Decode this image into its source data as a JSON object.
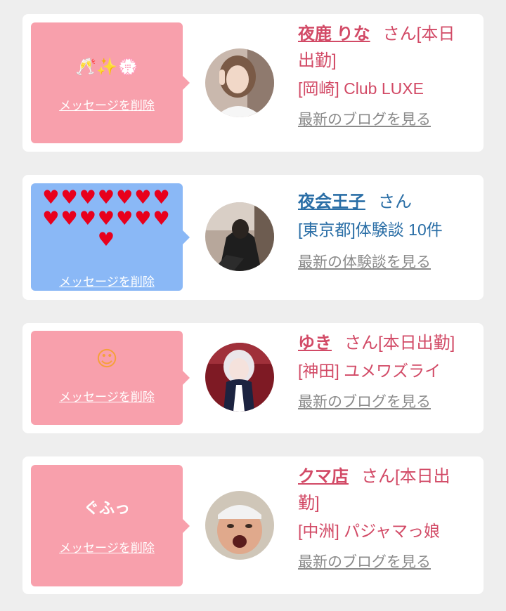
{
  "common": {
    "delete_label": "メッセージを削除"
  },
  "cards": [
    {
      "message": "🥂✨💮",
      "name": "夜鹿 りな",
      "suffix": "さん[本日出勤]",
      "detail": "[岡崎] Club LUXE",
      "link": "最新のブログを見る"
    },
    {
      "message": "♥♥♥♥♥♥♥♥♥♥♥♥♥♥♥",
      "name": "夜会王子",
      "suffix": "さん",
      "detail": "[東京都]体験談 10件",
      "link": "最新の体験談を見る"
    },
    {
      "message": "☺",
      "name": "ゆき",
      "suffix": "さん[本日出勤]",
      "detail": "[神田] ユメワズライ",
      "link": "最新のブログを見る"
    },
    {
      "message": "ぐふっ",
      "name": "クマ店",
      "suffix": "さん[本日出勤]",
      "detail": "[中洲] パジャマっ娘",
      "link": "最新のブログを見る"
    }
  ],
  "colors": {
    "bubble_pink": "#f8a0ac",
    "bubble_blue": "#8ab8f6",
    "text_pink": "#d24a66",
    "text_blue": "#2a6ea6",
    "link_gray": "#8a8a8a",
    "heart_red": "#e8001c",
    "smiley_orange": "#f5a03a"
  }
}
